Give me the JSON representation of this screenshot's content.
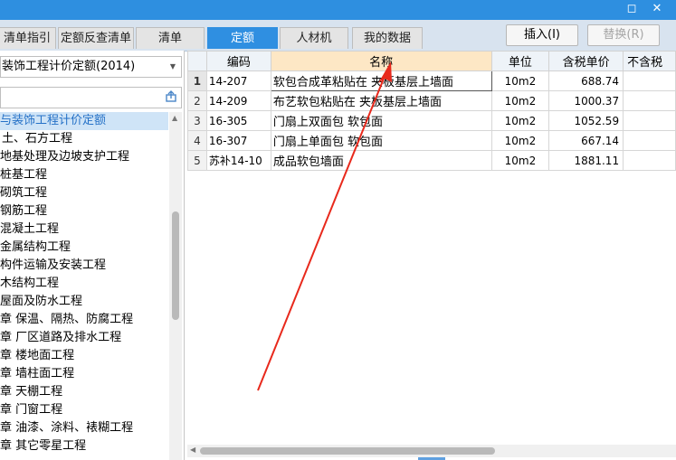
{
  "window": {
    "restore_glyph": "◻",
    "close_glyph": "✕"
  },
  "tabs": [
    {
      "label": "清单指引"
    },
    {
      "label": "定额反查清单"
    },
    {
      "label": "清单"
    },
    {
      "label": "定额"
    },
    {
      "label": "人材机"
    },
    {
      "label": "我的数据"
    }
  ],
  "actions": {
    "insert_label": "插入(I)",
    "replace_label": "替换(R)"
  },
  "left": {
    "quota_select_value": "装饰工程计价定额(2014)",
    "search_placeholder": "",
    "tree": [
      {
        "label": "与装饰工程计价定额"
      },
      {
        "label": "土、石方工程"
      },
      {
        "label": "地基处理及边坡支护工程"
      },
      {
        "label": "桩基工程"
      },
      {
        "label": "砌筑工程"
      },
      {
        "label": "钢筋工程"
      },
      {
        "label": "混凝土工程"
      },
      {
        "label": "金属结构工程"
      },
      {
        "label": "构件运输及安装工程"
      },
      {
        "label": "木结构工程"
      },
      {
        "label": "屋面及防水工程"
      },
      {
        "label": "章 保温、隔热、防腐工程"
      },
      {
        "label": "章 厂区道路及排水工程"
      },
      {
        "label": "章 楼地面工程"
      },
      {
        "label": "章 墙柱面工程"
      },
      {
        "label": "章 天棚工程"
      },
      {
        "label": "章 门窗工程"
      },
      {
        "label": "章 油漆、涂料、裱糊工程"
      },
      {
        "label": "章 其它零星工程"
      }
    ]
  },
  "grid": {
    "columns": [
      "编码",
      "名称",
      "单位",
      "含税单价",
      "不含税"
    ],
    "rows": [
      {
        "no": "1",
        "code": "14-207",
        "name": "软包合成革粘贴在 夹板基层上墙面",
        "unit": "10m2",
        "price": "688.74"
      },
      {
        "no": "2",
        "code": "14-209",
        "name": "布艺软包粘贴在 夹板基层上墙面",
        "unit": "10m2",
        "price": "1000.37"
      },
      {
        "no": "3",
        "code": "16-305",
        "name": "门扇上双面包 软包面",
        "unit": "10m2",
        "price": "1052.59"
      },
      {
        "no": "4",
        "code": "16-307",
        "name": "门扇上单面包 软包面",
        "unit": "10m2",
        "price": "667.14"
      },
      {
        "no": "5",
        "code": "苏补14-10",
        "name": "成品软包墙面",
        "unit": "10m2",
        "price": "1881.11"
      }
    ]
  },
  "colors": {
    "accent": "#2f8fe1",
    "annotation_arrow": "#e8291c"
  }
}
